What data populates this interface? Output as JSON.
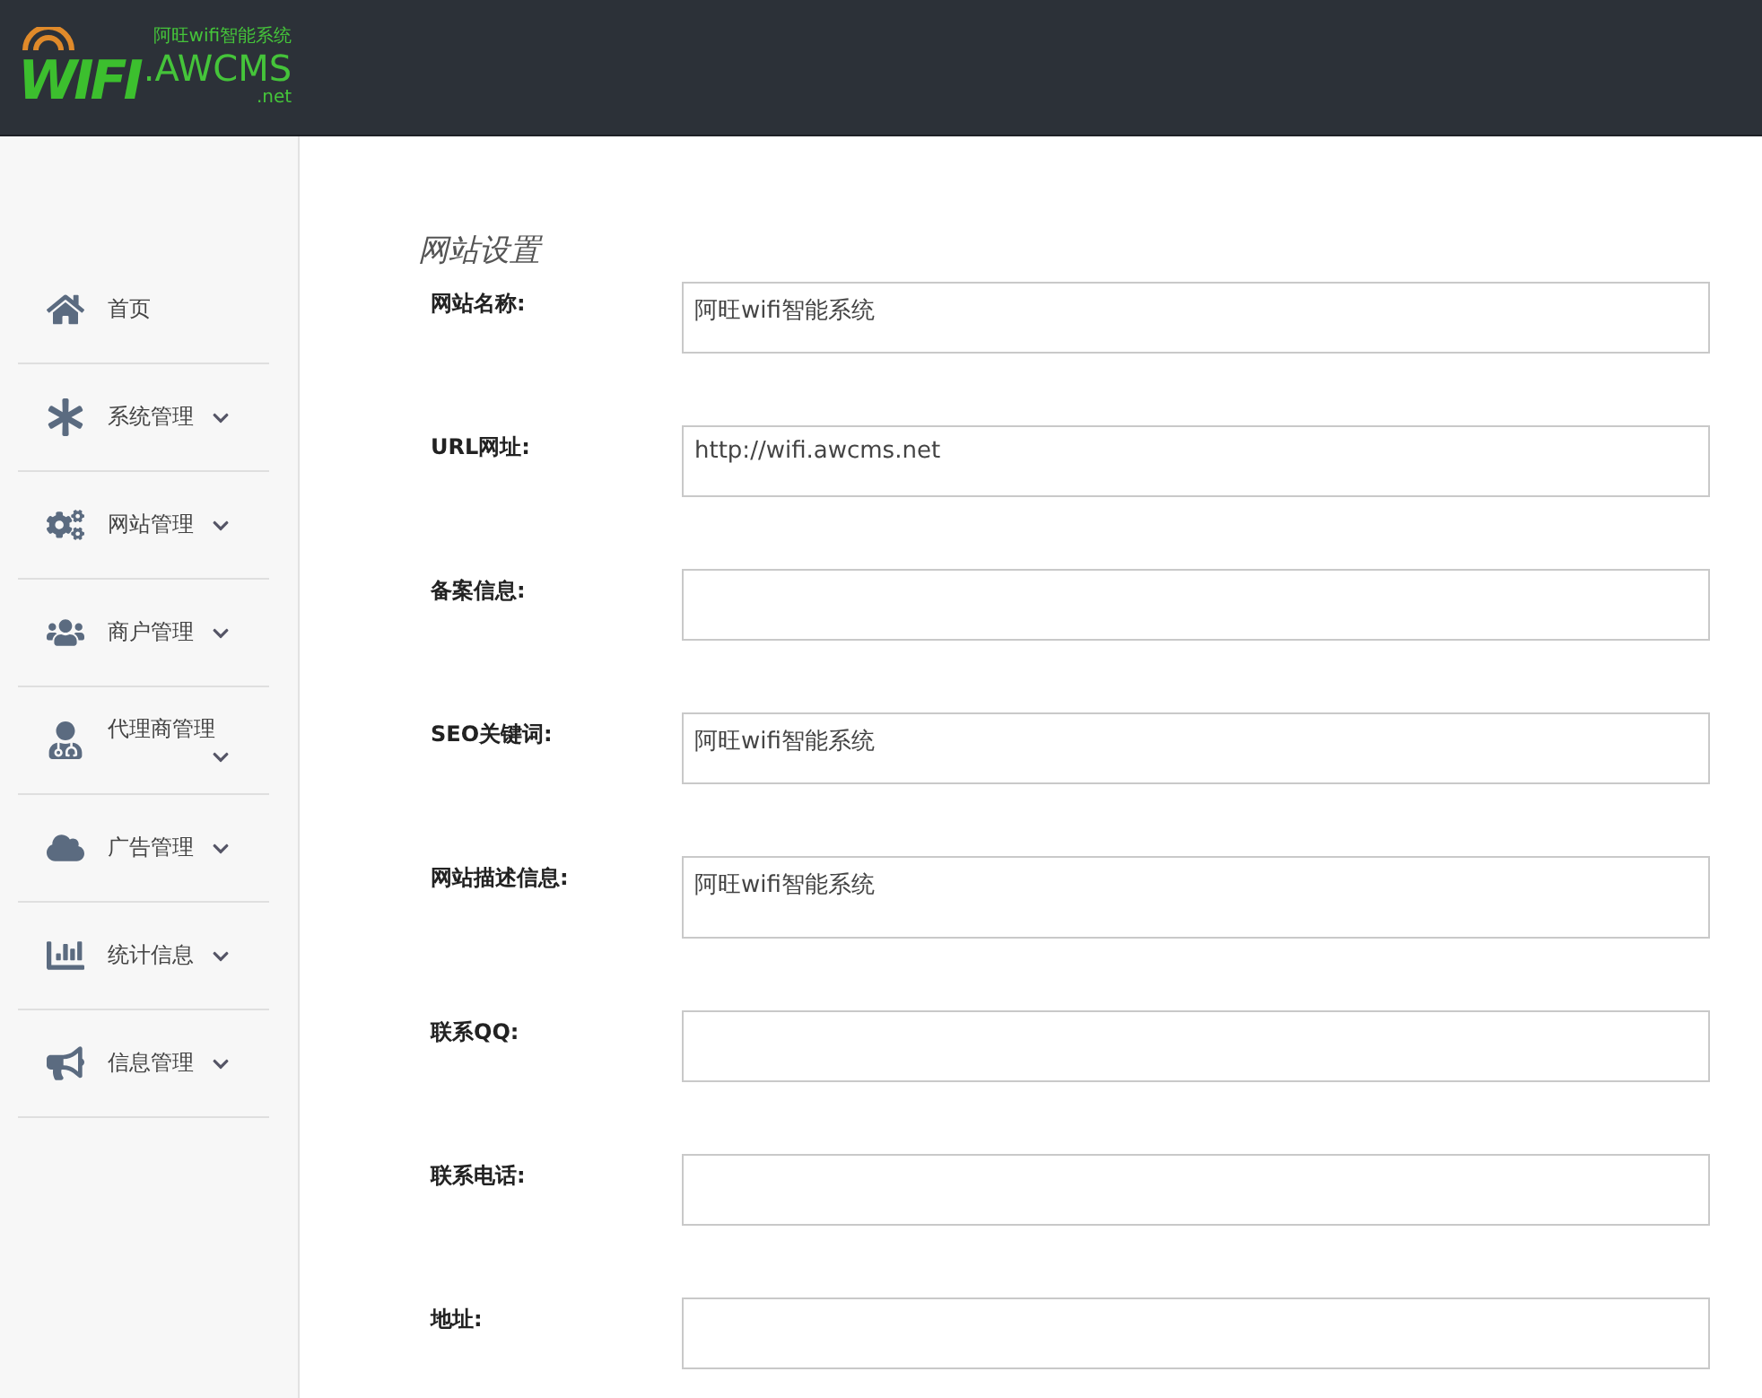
{
  "logo": {
    "tagline": "阿旺wifi智能系统",
    "mark": "WIFI",
    "brand": ".AWCMS",
    "domain": ".net"
  },
  "sidebar": {
    "items": [
      {
        "label": "首页",
        "expandable": false
      },
      {
        "label": "系统管理",
        "expandable": true
      },
      {
        "label": "网站管理",
        "expandable": true
      },
      {
        "label": "商户管理",
        "expandable": true
      },
      {
        "label": "代理商管理",
        "expandable": true
      },
      {
        "label": "广告管理",
        "expandable": true
      },
      {
        "label": "统计信息",
        "expandable": true
      },
      {
        "label": "信息管理",
        "expandable": true
      }
    ]
  },
  "form": {
    "title": "网站设置",
    "fields": [
      {
        "label": "网站名称:",
        "kind": "input",
        "value": "阿旺wifi智能系统"
      },
      {
        "label": "URL网址:",
        "kind": "input",
        "value": "http://wifi.awcms.net"
      },
      {
        "label": "备案信息:",
        "kind": "input"
      },
      {
        "label": "SEO关键词:",
        "kind": "input",
        "value": "阿旺wifi智能系统"
      },
      {
        "label": "网站描述信息:",
        "kind": "textarea",
        "value": "阿旺wifi智能系统"
      },
      {
        "label": "联系QQ:",
        "kind": "input"
      },
      {
        "label": "联系电话:",
        "kind": "input"
      },
      {
        "label": "地址:",
        "kind": "input"
      }
    ]
  }
}
